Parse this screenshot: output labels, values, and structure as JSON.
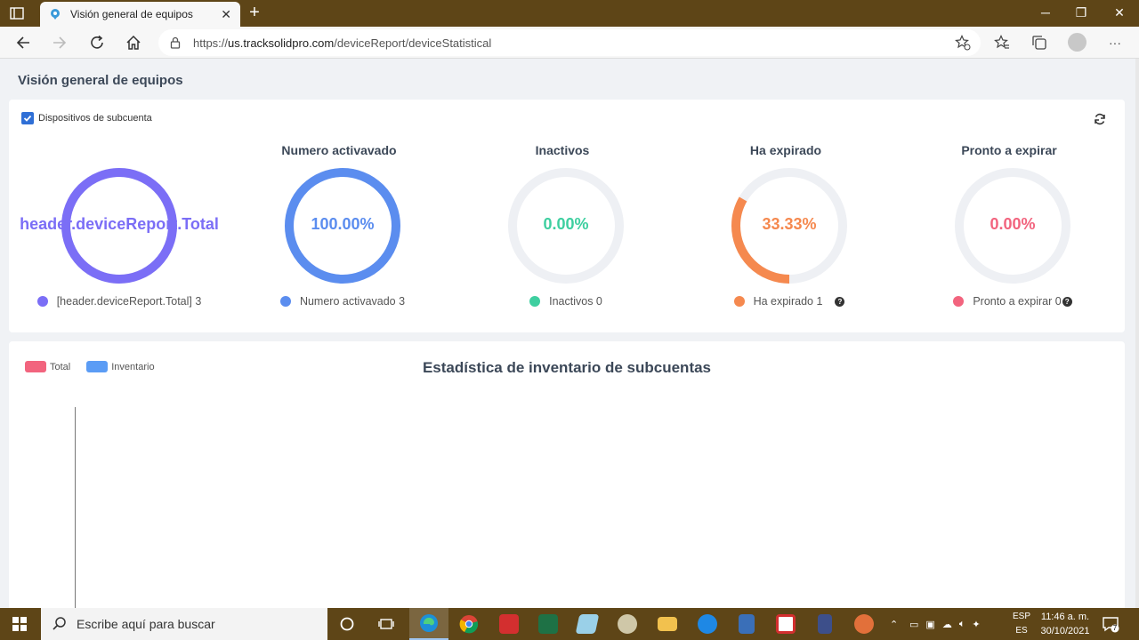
{
  "browser": {
    "tab_title": "Visión general de equipos",
    "url_prefix": "https://",
    "url_host": "us.tracksolidpro.com",
    "url_path": "/deviceReport/deviceStatistical",
    "new_tab_label": "+",
    "minimize_label": "─",
    "restore_label": "❐",
    "close_label": "✕",
    "menu_label": "···"
  },
  "page": {
    "title": "Visión general de equipos",
    "subaccount_checkbox_label": "Dispositivos de subcuenta",
    "subaccount_checked": true
  },
  "stats": [
    {
      "title": "",
      "center": "header.deviceReport.Total",
      "legend": "[header.deviceReport.Total] 3",
      "color": "#7b6ef6",
      "fraction": 1.0,
      "has_help": false
    },
    {
      "title": "Numero activavado",
      "center": "100.00%",
      "legend": "Numero activavado 3",
      "color": "#5b8def",
      "fraction": 1.0,
      "has_help": false
    },
    {
      "title": "Inactivos",
      "center": "0.00%",
      "legend": "Inactivos 0",
      "color": "#3ecfa0",
      "fraction": 0.0,
      "has_help": false
    },
    {
      "title": "Ha expirado",
      "center": "33.33%",
      "legend": "Ha expirado 1",
      "color": "#f5894f",
      "fraction": 0.3333,
      "has_help": true
    },
    {
      "title": "Pronto a expirar",
      "center": "0.00%",
      "legend": "Pronto a expirar 0",
      "color": "#f2647e",
      "fraction": 0.0,
      "has_help": true
    }
  ],
  "inventory_chart": {
    "title": "Estadística de inventario de subcuentas",
    "legend": [
      {
        "name": "Total",
        "color": "#f2647e"
      },
      {
        "name": "Inventario",
        "color": "#5b9cf5"
      }
    ]
  },
  "taskbar": {
    "search_placeholder": "Escribe aquí para buscar",
    "lang_line1": "ESP",
    "lang_line2": "ES",
    "time": "11:46 a. m.",
    "date": "30/10/2021",
    "notification_count": "7"
  }
}
